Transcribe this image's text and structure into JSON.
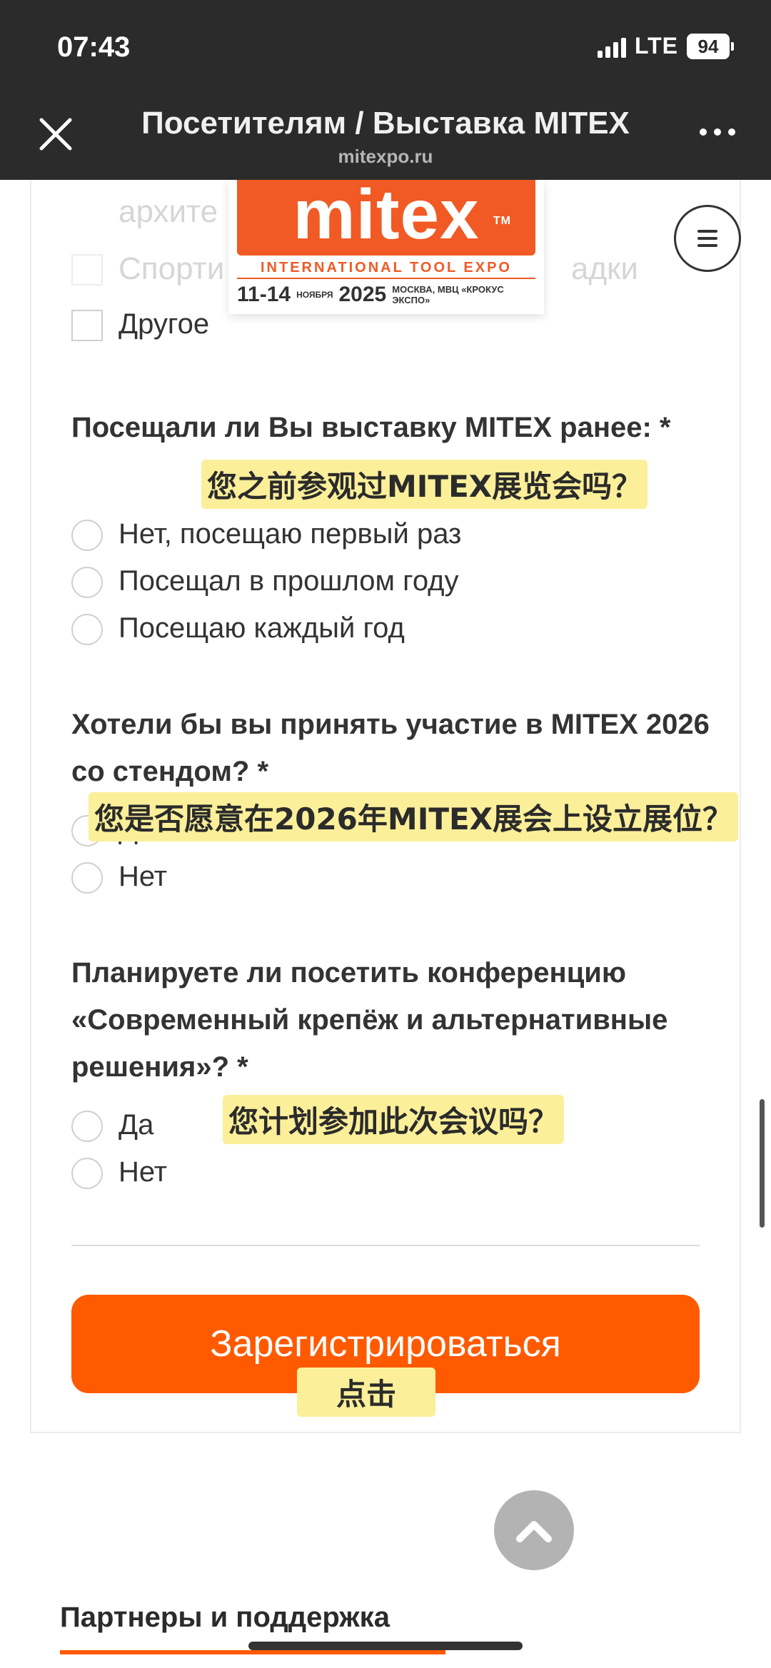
{
  "status_bar": {
    "time": "07:43",
    "network": "LTE",
    "battery": "94"
  },
  "browser": {
    "title": "Посетителям / Выставка MITEX",
    "domain": "mitexpo.ru"
  },
  "logo": {
    "brand": "mitex",
    "tagline": "INTERNATIONAL TOOL EXPO",
    "dates": "11-14",
    "month": "НОЯБРЯ",
    "year": "2025",
    "venue": "МОСКВА, МВЦ «КРОКУС ЭКСПО»"
  },
  "interest_options": {
    "partial_top": "архите",
    "sport_left": "Спорти",
    "sport_right": "адки",
    "other": "Другое"
  },
  "q1": {
    "title": "Посещали ли Вы выставку MITEX ранее: *",
    "options": [
      "Нет, посещаю первый раз",
      "Посещал в прошлом году",
      "Посещаю каждый год"
    ]
  },
  "q2": {
    "title": "Хотели бы вы принять участие в MITEX 2026 со стендом? *",
    "options": [
      "Да",
      "Нет"
    ]
  },
  "q3": {
    "title": "Планируете ли посетить конференцию «Современный крепёж и альтернативные решения»? *",
    "options": [
      "Да",
      "Нет"
    ]
  },
  "register_label": "Зарегистрироваться",
  "annotations": {
    "q1_note": "您之前参观过MITEX展览会吗？",
    "q2_note": "您是否愿意在2026年MITEX展会上设立展位？",
    "q3_note": "您计划参加此次会议吗？",
    "click_note": "点击"
  },
  "footer": {
    "partners_heading": "Партнеры и поддержка"
  },
  "colors": {
    "accent": "#ff5a00",
    "brand": "#f15a24",
    "header_bg": "#2b2b2b",
    "note_bg": "#fbef9a"
  }
}
